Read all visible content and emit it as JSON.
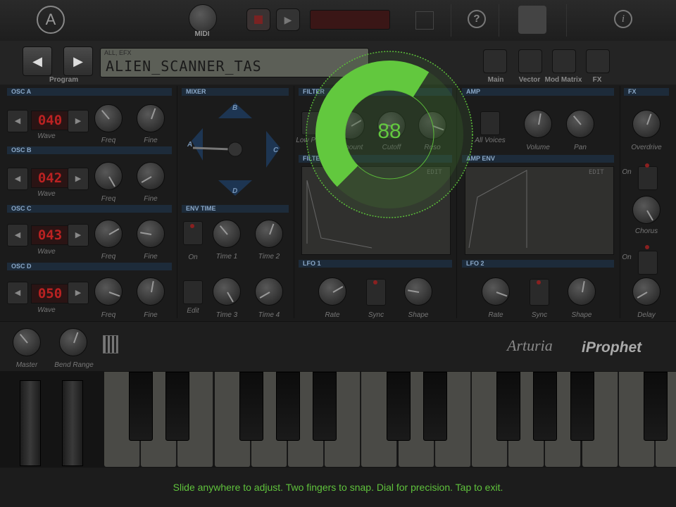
{
  "header": {
    "logo_glyph": "A",
    "midi_label": "MIDI",
    "help_glyph": "?",
    "info_glyph": "i"
  },
  "program": {
    "category": "ALL, EFX",
    "name": "ALIEN_SCANNER_TAS",
    "label": "Program",
    "prev_glyph": "◀",
    "next_glyph": "▶",
    "pages": [
      "Main",
      "Vector",
      "Mod Matrix",
      "FX"
    ]
  },
  "osc": {
    "a": {
      "title": "OSC A",
      "value": "040"
    },
    "b": {
      "title": "OSC B",
      "value": "042"
    },
    "c": {
      "title": "OSC C",
      "value": "043"
    },
    "d": {
      "title": "OSC D",
      "value": "050"
    },
    "wave_label": "Wave",
    "freq_label": "Freq",
    "fine_label": "Fine"
  },
  "mixer": {
    "title": "MIXER",
    "a": "A",
    "b": "B",
    "c": "C",
    "d": "D"
  },
  "env_time": {
    "title": "ENV TIME",
    "on": "On",
    "time1": "Time 1",
    "time2": "Time 2",
    "edit": "Edit",
    "time3": "Time 3",
    "time4": "Time 4"
  },
  "filter": {
    "title": "FILTER",
    "low_pass": "Low Pass",
    "amount": "Amount",
    "cutoff": "Cutoff",
    "reso": "Reso"
  },
  "filter_env": {
    "title": "FILTER ENV",
    "edit": "EDIT"
  },
  "amp": {
    "title": "AMP",
    "all_voices": "All Voices",
    "volume": "Volume",
    "pan": "Pan"
  },
  "amp_env": {
    "title": "AMP ENV",
    "edit": "EDIT"
  },
  "fx": {
    "title": "FX",
    "overdrive": "Overdrive",
    "on1": "On",
    "chorus": "Chorus",
    "on2": "On",
    "delay": "Delay"
  },
  "lfo1": {
    "title": "LFO 1",
    "rate": "Rate",
    "sync": "Sync",
    "shape": "Shape"
  },
  "lfo2": {
    "title": "LFO 2",
    "rate": "Rate",
    "sync": "Sync",
    "shape": "Shape"
  },
  "bottom": {
    "master": "Master",
    "bend_range": "Bend Range",
    "brand": "Arturia",
    "product": "iProphet"
  },
  "dial": {
    "value": "88",
    "fill_fraction": 0.62,
    "color": "#62c83e"
  },
  "hint": "Slide anywhere to adjust. Two fingers to snap. Dial for precision. Tap to exit."
}
